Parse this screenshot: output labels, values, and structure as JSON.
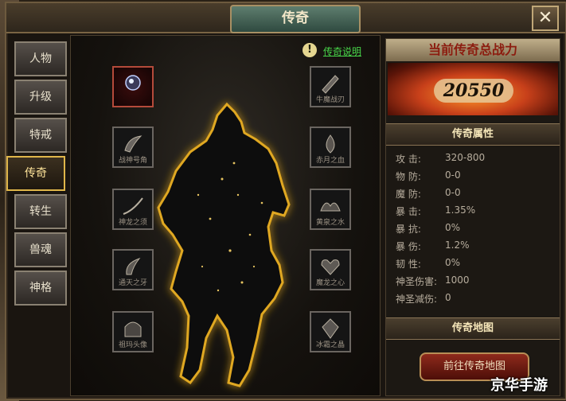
{
  "window": {
    "title": "传奇",
    "close_label": "✕"
  },
  "tabs": [
    {
      "label": "人物"
    },
    {
      "label": "升级"
    },
    {
      "label": "特戒"
    },
    {
      "label": "传奇",
      "active": true
    },
    {
      "label": "转生"
    },
    {
      "label": "兽魂"
    },
    {
      "label": "神格"
    }
  ],
  "help": {
    "icon": "!",
    "link": "传奇说明"
  },
  "slots_left": [
    {
      "label": "",
      "icon": "orb-icon"
    },
    {
      "label": "战神号角",
      "icon": "horn-icon"
    },
    {
      "label": "神龙之须",
      "icon": "whisker-icon"
    },
    {
      "label": "通天之牙",
      "icon": "fang-icon"
    },
    {
      "label": "祖玛头像",
      "icon": "helm-icon"
    }
  ],
  "slots_right": [
    {
      "label": "牛魔战刃",
      "icon": "blade-icon"
    },
    {
      "label": "赤月之血",
      "icon": "blood-icon"
    },
    {
      "label": "黄泉之水",
      "icon": "water-icon"
    },
    {
      "label": "魔龙之心",
      "icon": "heart-icon"
    },
    {
      "label": "冰霜之晶",
      "icon": "crystal-icon"
    }
  ],
  "power": {
    "title": "当前传奇总战力",
    "value": "20550"
  },
  "attributes_header": "传奇属性",
  "attributes": [
    {
      "key": "攻 击:",
      "value": "320-800"
    },
    {
      "key": "物 防:",
      "value": "0-0"
    },
    {
      "key": "魔 防:",
      "value": "0-0"
    },
    {
      "key": "暴 击:",
      "value": "1.35%"
    },
    {
      "key": "暴 抗:",
      "value": "0%"
    },
    {
      "key": "暴 伤:",
      "value": "1.2%"
    },
    {
      "key": "韧 性:",
      "value": "0%"
    },
    {
      "key": "神圣伤害:",
      "value": "1000"
    },
    {
      "key": "神圣减伤:",
      "value": "0"
    }
  ],
  "map_header": "传奇地图",
  "map_button": "前往传奇地图",
  "watermark": "京华手游"
}
